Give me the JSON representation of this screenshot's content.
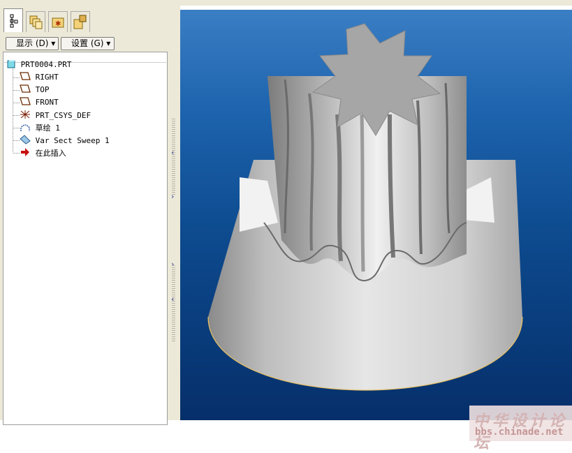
{
  "toolbar": {
    "display_label": "显示 (D) ▾",
    "settings_label": "设置 (G) ▾"
  },
  "tabs": [
    {
      "icon": "model-tree-icon",
      "active": true
    },
    {
      "icon": "folder-browser-icon",
      "active": false
    },
    {
      "icon": "favorites-icon",
      "active": false
    },
    {
      "icon": "connections-icon",
      "active": false
    }
  ],
  "model_tree": {
    "root": {
      "label": "PRT0004.PRT",
      "icon": "part-icon"
    },
    "items": [
      {
        "label": "RIGHT",
        "icon": "datum-plane-icon"
      },
      {
        "label": "TOP",
        "icon": "datum-plane-icon"
      },
      {
        "label": "FRONT",
        "icon": "datum-plane-icon"
      },
      {
        "label": "PRT_CSYS_DEF",
        "icon": "coordinate-system-icon"
      },
      {
        "label": "草绘 1",
        "icon": "sketch-icon"
      },
      {
        "label": "Var Sect Sweep 1",
        "icon": "sweep-icon"
      },
      {
        "label": "在此插入",
        "icon": "insert-here-arrow-icon"
      }
    ]
  },
  "viewport": {
    "background_top": "#3a7ec4",
    "background_bottom": "#062f6a",
    "model_color": "#c8c8c8",
    "edge_highlight": "#e8c060"
  },
  "watermark": {
    "name": "中华设计论坛",
    "url": "bbs.chinade.net"
  }
}
